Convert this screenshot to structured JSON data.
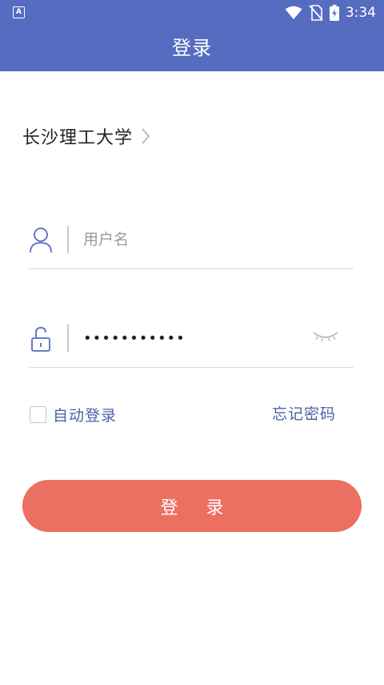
{
  "status_bar": {
    "time": "3:34",
    "app_badge": "A"
  },
  "header": {
    "title": "登录"
  },
  "school": {
    "name": "长沙理工大学"
  },
  "username": {
    "placeholder": "用户名",
    "value": ""
  },
  "password": {
    "value": "•••••••••••"
  },
  "remember": {
    "label": "自动登录",
    "checked": false
  },
  "forgot": {
    "label": "忘记密码"
  },
  "login_button": {
    "label": "登 录"
  },
  "colors": {
    "header": "#566cc0",
    "accent": "#4d5fa9",
    "button": "#ec7062"
  }
}
